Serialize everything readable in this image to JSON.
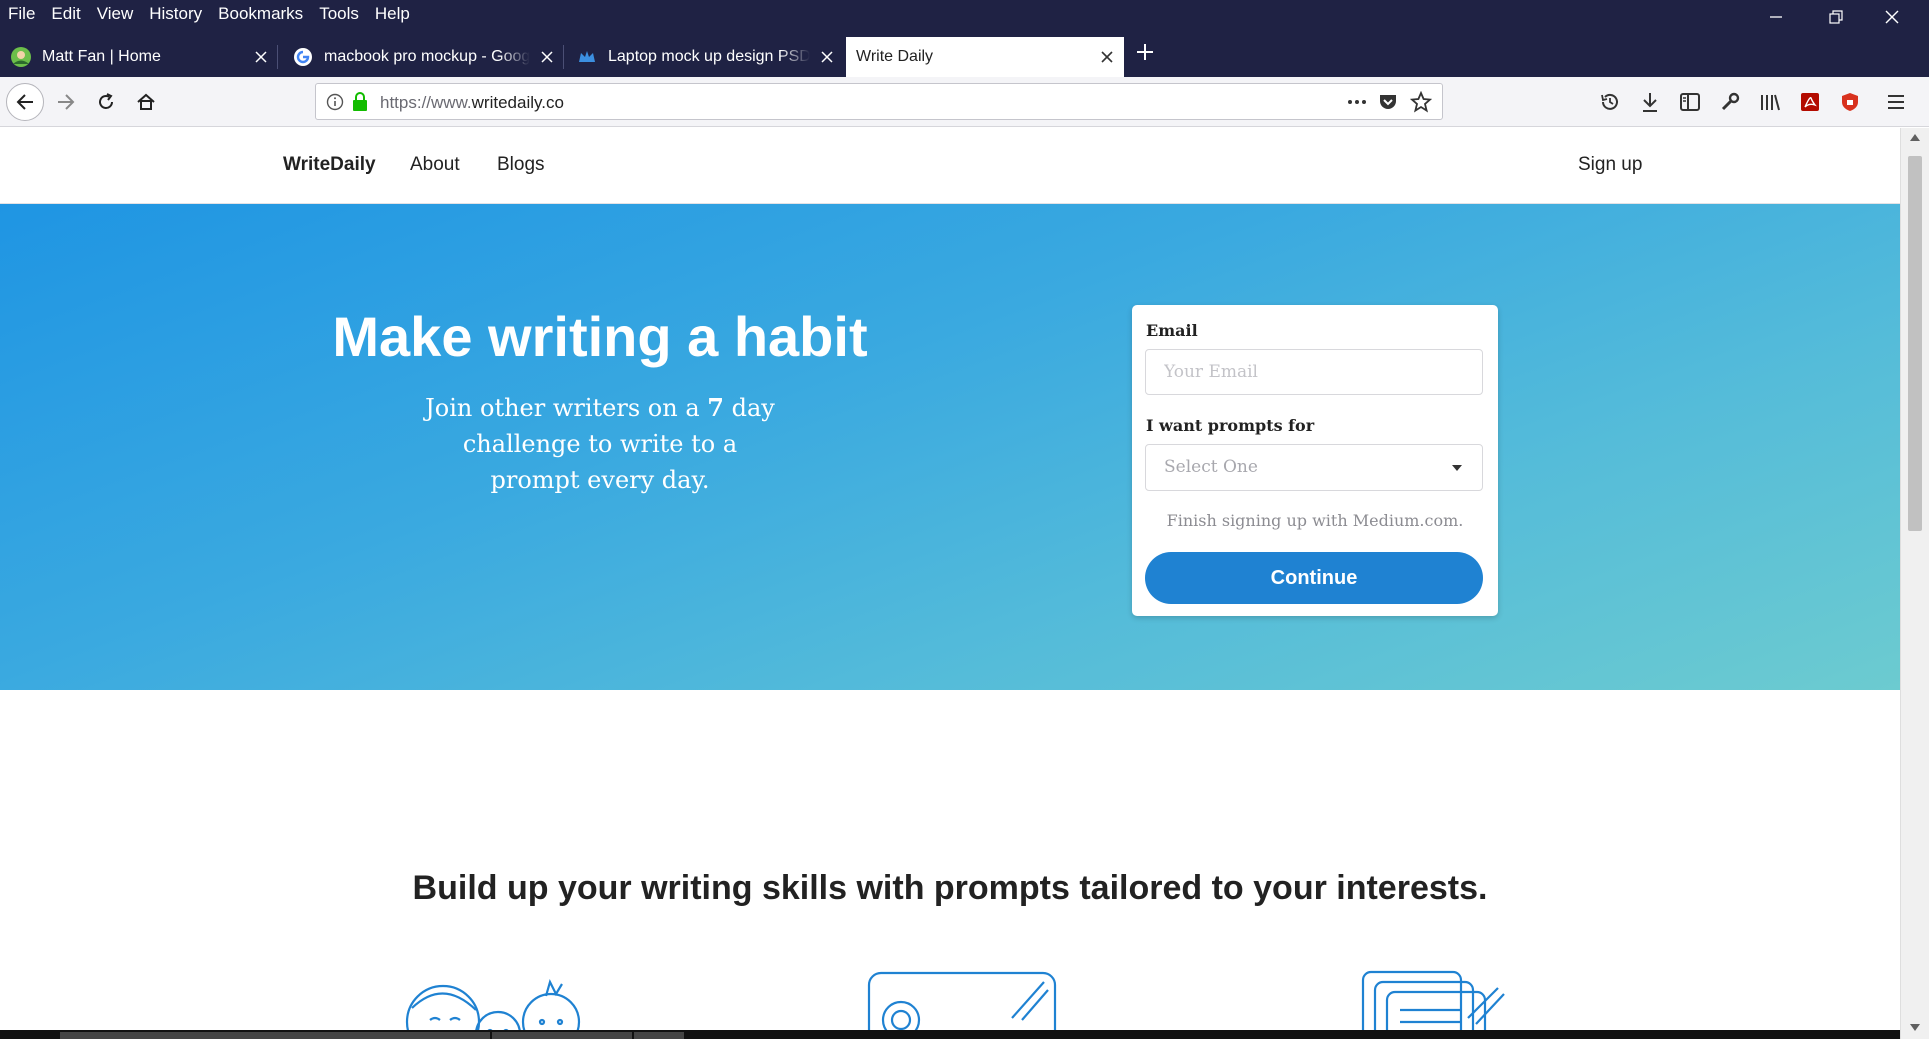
{
  "menubar": {
    "items": [
      "File",
      "Edit",
      "View",
      "History",
      "Bookmarks",
      "Tools",
      "Help"
    ]
  },
  "tabs": [
    {
      "title": "Matt Fan | Home",
      "icon": "avatar-favicon-icon"
    },
    {
      "title": "macbook pro mockup - Google",
      "icon": "google-favicon-icon"
    },
    {
      "title": "Laptop mock up design PSD file",
      "icon": "crown-favicon-icon"
    },
    {
      "title": "Write Daily",
      "icon": "none"
    }
  ],
  "urlbar": {
    "prefix": "https://www.",
    "domain": "writedaily.co"
  },
  "site": {
    "brand": "WriteDaily",
    "nav": [
      "About",
      "Blogs"
    ],
    "signup": "Sign up"
  },
  "hero": {
    "title": "Make writing a habit",
    "subtitle_pre": "Join other writers on a ",
    "subtitle_bold": "7",
    "subtitle_post": " day challenge to write to a prompt every day."
  },
  "form": {
    "email_label": "Email",
    "email_placeholder": "Your Email",
    "prompts_label": "I want prompts for",
    "select_value": "Select One",
    "note": "Finish signing up with Medium.com.",
    "submit": "Continue"
  },
  "section": {
    "heading_pre": "Build up your writing skills with prompts tailored to ",
    "heading_bold": "your interests."
  },
  "colors": {
    "chrome": "#1f2244",
    "hero_start": "#1f95e3",
    "hero_end": "#6ccbd0",
    "accent": "#1f82d2",
    "illustration": "#1f82d2"
  }
}
